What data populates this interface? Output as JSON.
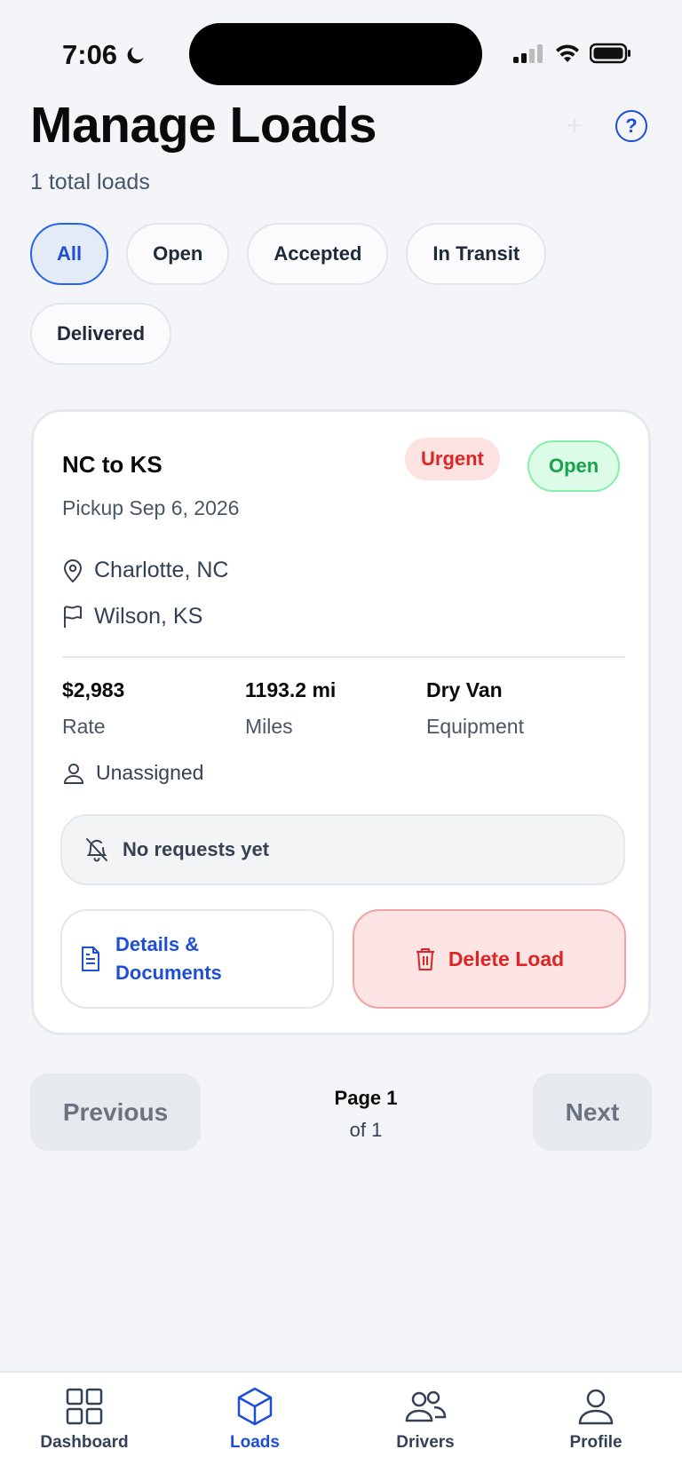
{
  "status_bar": {
    "time": "7:06"
  },
  "header": {
    "title": "Manage Loads",
    "subtitle": "1 total loads",
    "add_icon": "plus-icon",
    "help_icon": "help-circle-icon",
    "help_glyph": "?"
  },
  "filters": {
    "selected": "All",
    "items": [
      "All",
      "Open",
      "Accepted",
      "In Transit",
      "Delivered"
    ]
  },
  "load": {
    "route": "NC to KS",
    "pickup": "Pickup Sep 6, 2026",
    "priority_badge": "Urgent",
    "status_badge": "Open",
    "origin": "Charlotte, NC",
    "destination": "Wilson, KS",
    "rate_value": "$2,983",
    "rate_label": "Rate",
    "miles_value": "1193.2 mi",
    "miles_label": "Miles",
    "equipment_value": "Dry Van",
    "equipment_label": "Equipment",
    "driver": "Unassigned",
    "requests": "No requests yet",
    "details_button_line1": "Details &",
    "details_button_line2": "Documents",
    "delete_button": "Delete Load"
  },
  "pagination": {
    "previous": "Previous",
    "next": "Next",
    "page": "Page 1",
    "of": "of 1"
  },
  "tabbar": {
    "selected": "Loads",
    "items": [
      {
        "label": "Dashboard",
        "icon": "grid-icon"
      },
      {
        "label": "Loads",
        "icon": "box-icon"
      },
      {
        "label": "Drivers",
        "icon": "users-icon"
      },
      {
        "label": "Profile",
        "icon": "user-icon"
      }
    ]
  },
  "colors": {
    "accent": "#1d4ed8",
    "urgent": "#dc2626",
    "open": "#16a34a",
    "background": "#f3f5f9"
  }
}
